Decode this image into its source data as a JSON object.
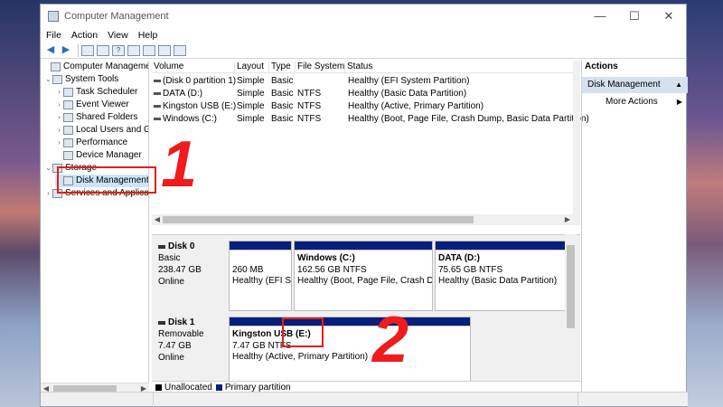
{
  "window": {
    "title": "Computer Management",
    "controls": {
      "minimize": "—",
      "maximize": "☐",
      "close": "✕"
    }
  },
  "menu": [
    "File",
    "Action",
    "View",
    "Help"
  ],
  "toolbar": {
    "back": "◀",
    "forward": "▶"
  },
  "tree": [
    {
      "label": "Computer Management",
      "exp": "",
      "level": 0
    },
    {
      "label": "System Tools",
      "exp": "⌄",
      "level": 1
    },
    {
      "label": "Task Scheduler",
      "exp": "›",
      "level": 2
    },
    {
      "label": "Event Viewer",
      "exp": "›",
      "level": 2
    },
    {
      "label": "Shared Folders",
      "exp": "›",
      "level": 2
    },
    {
      "label": "Local Users and Gr",
      "exp": "›",
      "level": 2
    },
    {
      "label": "Performance",
      "exp": "›",
      "level": 2
    },
    {
      "label": "Device Manager",
      "exp": "",
      "level": 2
    },
    {
      "label": "Storage",
      "exp": "⌄",
      "level": 1
    },
    {
      "label": "Disk Management",
      "exp": "",
      "level": 2,
      "selected": true
    },
    {
      "label": "Services and Applicat",
      "exp": "›",
      "level": 1
    }
  ],
  "volume_table": {
    "headers": [
      "Volume",
      "Layout",
      "Type",
      "File System",
      "Status"
    ],
    "rows": [
      [
        "(Disk 0 partition 1)",
        "Simple",
        "Basic",
        "",
        "Healthy (EFI System Partition)"
      ],
      [
        "DATA (D:)",
        "Simple",
        "Basic",
        "NTFS",
        "Healthy (Basic Data Partition)"
      ],
      [
        "Kingston USB (E:)",
        "Simple",
        "Basic",
        "NTFS",
        "Healthy (Active, Primary Partition)"
      ],
      [
        "Windows (C:)",
        "Simple",
        "Basic",
        "NTFS",
        "Healthy (Boot, Page File, Crash Dump, Basic Data Partition)"
      ]
    ]
  },
  "disks": [
    {
      "name": "Disk 0",
      "kind": "Basic",
      "size": "238.47 GB",
      "state": "Online",
      "partitions": [
        {
          "title": "",
          "size": "260 MB",
          "status": "Healthy (EFI Sy"
        },
        {
          "title": "Windows  (C:)",
          "size": "162.56 GB NTFS",
          "status": "Healthy (Boot, Page File, Crash Dur"
        },
        {
          "title": "DATA  (D:)",
          "size": "75.65 GB NTFS",
          "status": "Healthy (Basic Data Partition)"
        }
      ]
    },
    {
      "name": "Disk 1",
      "kind": "Removable",
      "size": "7.47 GB",
      "state": "Online",
      "partitions": [
        {
          "title": "Kingston USB  (E:)",
          "size": "7.47 GB NTFS",
          "status": "Healthy (Active, Primary Partition)"
        }
      ]
    }
  ],
  "legend": [
    {
      "label": "Unallocated",
      "color": "#000000"
    },
    {
      "label": "Primary partition",
      "color": "#0a1f7a"
    }
  ],
  "actions": {
    "title": "Actions",
    "section": "Disk Management",
    "items": [
      "More Actions"
    ]
  },
  "annotations": {
    "one": "1",
    "two": "2",
    "color": "#e0201a"
  }
}
